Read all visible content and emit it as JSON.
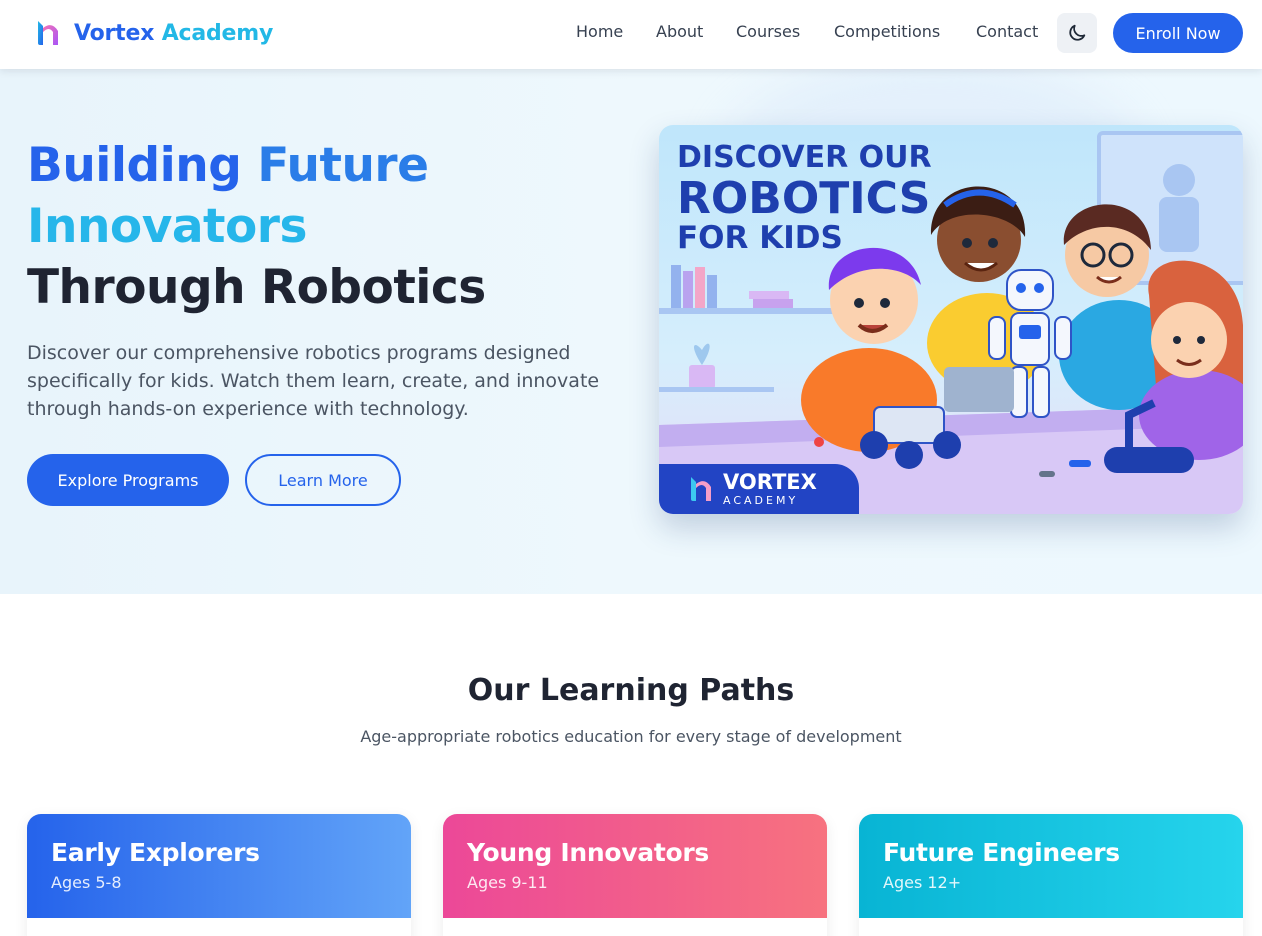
{
  "nav": {
    "brand": {
      "part1": "Vortex",
      "part2": "Academy"
    },
    "links": [
      "Home",
      "About",
      "Courses",
      "Competitions",
      "Contact"
    ],
    "theme_icon": "moon-icon",
    "enroll_label": "Enroll Now"
  },
  "hero": {
    "title_line1_a": "Building",
    "title_line1_b": "Future",
    "title_line2": "Innovators",
    "title_line3": "Through Robotics",
    "description": "Discover our comprehensive robotics programs designed specifically for kids. Watch them learn, create, and innovate through hands-on experience with technology.",
    "primary_cta": "Explore Programs",
    "secondary_cta": "Learn More",
    "image": {
      "heading_line1": "DISCOVER OUR",
      "heading_line2": "ROBOTICS",
      "heading_line3": "FOR KIDS",
      "badge_name": "VORTEX",
      "badge_sub": "ACADEMY"
    }
  },
  "learning_paths": {
    "title": "Our Learning Paths",
    "subtitle": "Age-appropriate robotics education for every stage of development",
    "cards": [
      {
        "title": "Early Explorers",
        "ages": "Ages 5-8"
      },
      {
        "title": "Young Innovators",
        "ages": "Ages 9-11"
      },
      {
        "title": "Future Engineers",
        "ages": "Ages 12+"
      }
    ]
  },
  "colors": {
    "primary": "#2563eb",
    "accent_cyan": "#26b6ea",
    "pink": "#ec4898",
    "teal": "#08b4d4"
  }
}
